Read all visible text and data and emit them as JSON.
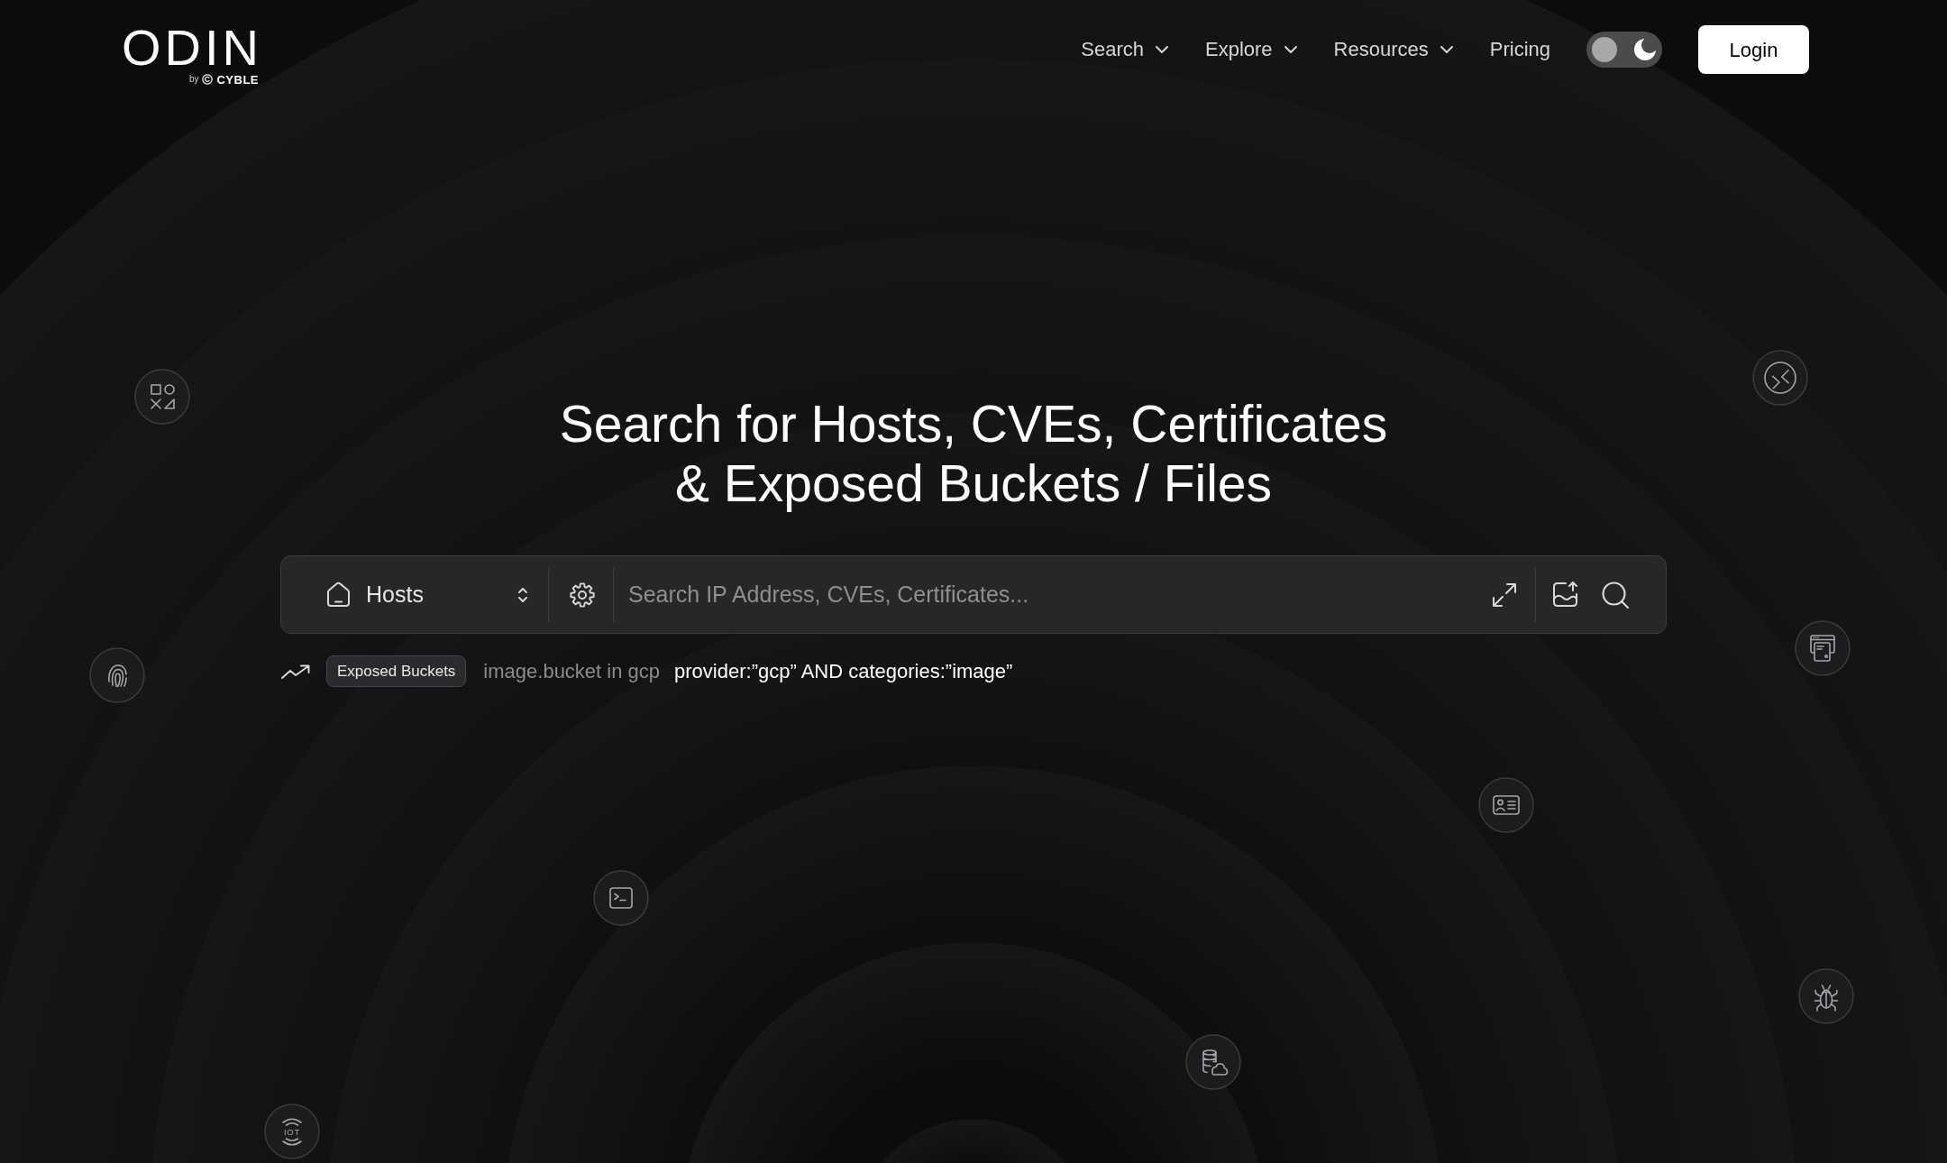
{
  "logo": {
    "wordmark": "ODIN",
    "byline": "by",
    "brand": "CYBLE"
  },
  "nav": [
    {
      "label": "Search",
      "kind": "dropdown"
    },
    {
      "label": "Explore",
      "kind": "dropdown"
    },
    {
      "label": "Resources",
      "kind": "dropdown"
    },
    {
      "label": "Pricing",
      "kind": "link"
    }
  ],
  "theme_toggle": {
    "dark": true
  },
  "login_button": {
    "label": "Login"
  },
  "hero": {
    "title_lines": [
      "Search for Hosts, CVEs, Certificates",
      "& Exposed Buckets / Files"
    ]
  },
  "search": {
    "type_select": {
      "value": "Hosts"
    },
    "placeholder": "Search IP Address, CVEs, Certificates..."
  },
  "suggestion": {
    "tag": "Exposed Buckets",
    "description": "image.bucket in gcp",
    "query": "provider:”gcp” AND categories:”image”"
  },
  "iot_icon": {
    "label": "IOT"
  }
}
